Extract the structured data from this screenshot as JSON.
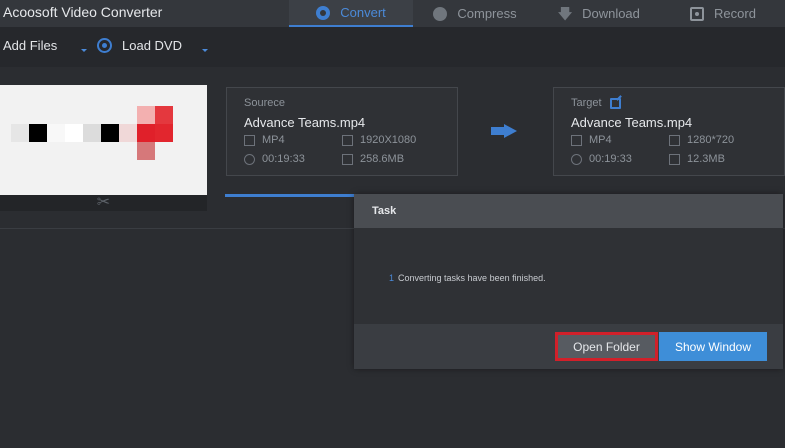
{
  "app": {
    "title": "Acoosoft Video Converter"
  },
  "nav": {
    "tabs": [
      {
        "label": "Convert",
        "icon": "convert-icon",
        "active": true
      },
      {
        "label": "Compress",
        "icon": "compress-icon",
        "active": false
      },
      {
        "label": "Download",
        "icon": "download-icon",
        "active": false
      },
      {
        "label": "Record",
        "icon": "record-icon",
        "active": false
      }
    ]
  },
  "toolbar": {
    "add_files_label": "Add Files",
    "load_dvd_label": "Load DVD"
  },
  "source": {
    "label": "Sourece",
    "file_name": "Advance Teams.mp4",
    "format": "MP4",
    "resolution": "1920X1080",
    "duration": "00:19:33",
    "size": "258.6MB"
  },
  "target": {
    "label": "Target",
    "file_name": "Advance Teams.mp4",
    "format": "MP4",
    "resolution": "1280*720",
    "duration": "00:19:33",
    "size": "12.3MB"
  },
  "modal": {
    "title": "Task",
    "count": "1",
    "message": "Converting tasks have been finished.",
    "open_folder_label": "Open Folder",
    "show_window_label": "Show Window"
  },
  "colors": {
    "accent": "#3e7ed0",
    "highlight": "#d1202a",
    "background": "#2b2d31"
  }
}
